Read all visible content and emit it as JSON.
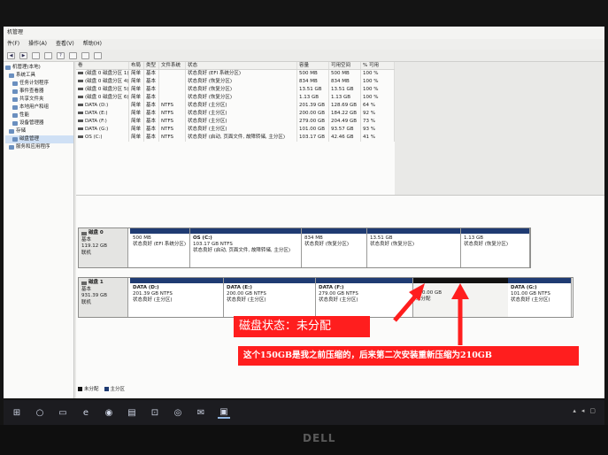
{
  "window": {
    "title": "机管理",
    "menu": [
      "件(F)",
      "操作(A)",
      "查看(V)",
      "帮助(H)"
    ]
  },
  "tree": [
    {
      "label": "机管理(本地)",
      "level": 0
    },
    {
      "label": "系统工具",
      "level": 1
    },
    {
      "label": "任务计划程序",
      "level": 2
    },
    {
      "label": "事件查看器",
      "level": 2
    },
    {
      "label": "共享文件夹",
      "level": 2
    },
    {
      "label": "本地用户和组",
      "level": 2
    },
    {
      "label": "性能",
      "level": 2
    },
    {
      "label": "设备管理器",
      "level": 2
    },
    {
      "label": "存储",
      "level": 1
    },
    {
      "label": "磁盘管理",
      "level": 2,
      "selected": true
    },
    {
      "label": "服务和应用程序",
      "level": 1
    }
  ],
  "volume_list": {
    "headers": [
      "卷",
      "布局",
      "类型",
      "文件系统",
      "状态",
      "容量",
      "可用空间",
      "% 可用"
    ],
    "rows": [
      [
        "(磁盘 0 磁盘分区 1)",
        "简单",
        "基本",
        "",
        "状态良好 (EFI 系统分区)",
        "500 MB",
        "500 MB",
        "100 %"
      ],
      [
        "(磁盘 0 磁盘分区 4)",
        "简单",
        "基本",
        "",
        "状态良好 (恢复分区)",
        "834 MB",
        "834 MB",
        "100 %"
      ],
      [
        "(磁盘 0 磁盘分区 5)",
        "简单",
        "基本",
        "",
        "状态良好 (恢复分区)",
        "13.51 GB",
        "13.51 GB",
        "100 %"
      ],
      [
        "(磁盘 0 磁盘分区 6)",
        "简单",
        "基本",
        "",
        "状态良好 (恢复分区)",
        "1.13 GB",
        "1.13 GB",
        "100 %"
      ],
      [
        "DATA (D:)",
        "简单",
        "基本",
        "NTFS",
        "状态良好 (主分区)",
        "201.39 GB",
        "128.69 GB",
        "64 %"
      ],
      [
        "DATA (E:)",
        "简单",
        "基本",
        "NTFS",
        "状态良好 (主分区)",
        "200.00 GB",
        "184.22 GB",
        "92 %"
      ],
      [
        "DATA (F:)",
        "简单",
        "基本",
        "NTFS",
        "状态良好 (主分区)",
        "279.00 GB",
        "204.49 GB",
        "73 %"
      ],
      [
        "DATA (G:)",
        "简单",
        "基本",
        "NTFS",
        "状态良好 (主分区)",
        "101.00 GB",
        "93.57 GB",
        "93 %"
      ],
      [
        "OS (C:)",
        "简单",
        "基本",
        "NTFS",
        "状态良好 (启动, 页面文件, 故障转储, 主分区)",
        "103.17 GB",
        "42.46 GB",
        "41 %"
      ]
    ]
  },
  "disks": [
    {
      "name": "磁盘 0",
      "type": "基本",
      "size": "119.12 GB",
      "status": "联机",
      "partitions": [
        {
          "name": "",
          "size": "500 MB",
          "status": "状态良好 (EFI 系统分区)"
        },
        {
          "name": "OS (C:)",
          "size": "103.17 GB NTFS",
          "status": "状态良好 (启动, 页面文件, 故障转储, 主分区)"
        },
        {
          "name": "",
          "size": "834 MB",
          "status": "状态良好 (恢复分区)"
        },
        {
          "name": "",
          "size": "13.51 GB",
          "status": "状态良好 (恢复分区)"
        },
        {
          "name": "",
          "size": "1.13 GB",
          "status": "状态良好 (恢复分区)"
        }
      ]
    },
    {
      "name": "磁盘 1",
      "type": "基本",
      "size": "931.39 GB",
      "status": "联机",
      "partitions": [
        {
          "name": "DATA (D:)",
          "size": "201.39 GB NTFS",
          "status": "状态良好 (主分区)"
        },
        {
          "name": "DATA (E:)",
          "size": "200.00 GB NTFS",
          "status": "状态良好 (主分区)"
        },
        {
          "name": "DATA (F:)",
          "size": "279.00 GB NTFS",
          "status": "状态良好 (主分区)"
        },
        {
          "name": "",
          "size": "150.00 GB",
          "status": "未分配"
        },
        {
          "name": "DATA (G:)",
          "size": "101.00 GB NTFS",
          "status": "状态良好 (主分区)"
        }
      ]
    }
  ],
  "legend": [
    "未分配",
    "主分区"
  ],
  "colors": {
    "primary_partition": "#1f3b72",
    "unallocated": "#111111",
    "callout": "#ff1e1e"
  },
  "annotations": {
    "status": "磁盘状态：未分配",
    "note": "这个150GB是我之前压缩的，后来第二次安装重新压缩为210GB"
  },
  "taskbar": {
    "icons": [
      "windows-icon",
      "search-icon",
      "task-view-icon",
      "edge-icon",
      "chrome-icon",
      "explorer-icon",
      "store-icon",
      "safari-icon",
      "mail-icon",
      "computer-management-icon"
    ]
  },
  "bezel": {
    "brand": "DELL"
  }
}
